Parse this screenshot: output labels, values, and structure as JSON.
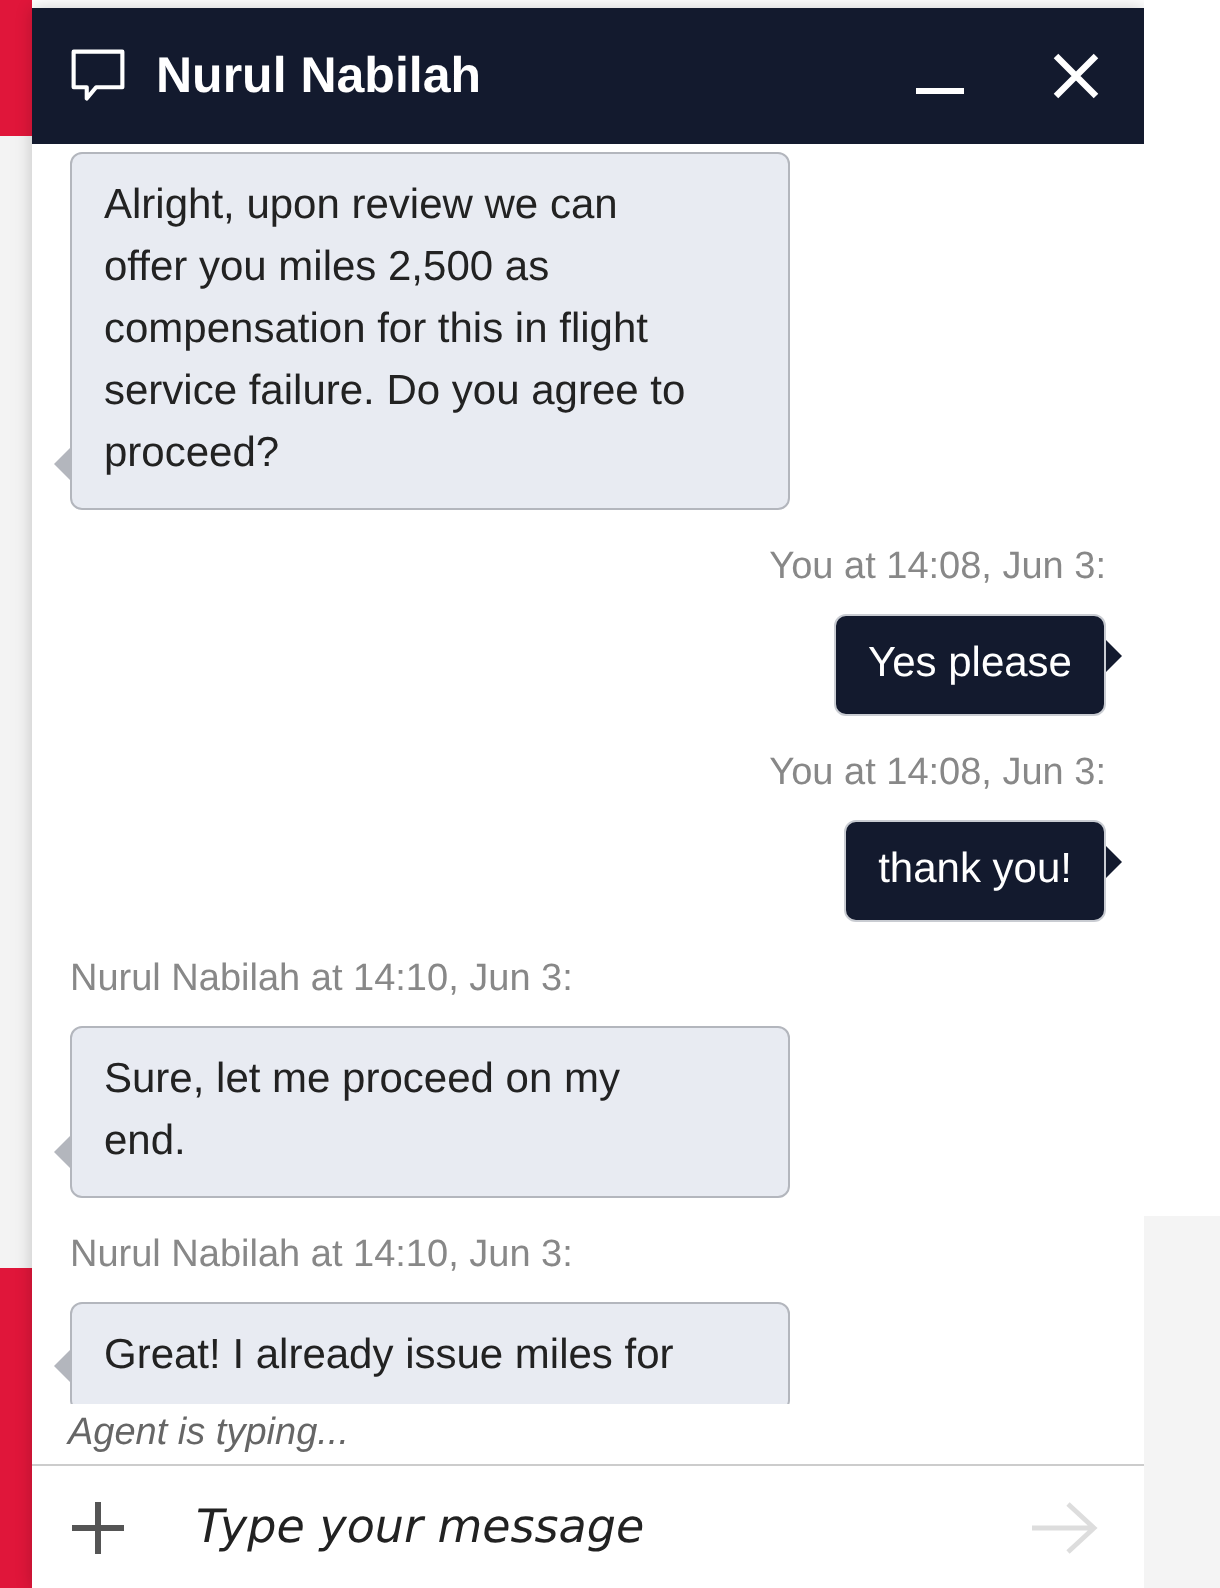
{
  "window": {
    "title": "Nurul Nabilah"
  },
  "messages": [
    {
      "kind": "agent",
      "text": "Alright, upon review we can offer you miles 2,500 as compensation for this in flight service failure. Do you agree to proceed?"
    },
    {
      "kind": "user",
      "meta": "You at 14:08, Jun 3:",
      "text": "Yes please"
    },
    {
      "kind": "user",
      "meta": "You at 14:08, Jun 3:",
      "text": "thank you!"
    },
    {
      "kind": "agent",
      "meta": "Nurul Nabilah at 14:10, Jun 3:",
      "text": "Sure, let me proceed on my end."
    },
    {
      "kind": "agent",
      "meta": "Nurul Nabilah at 14:10, Jun 3:",
      "text": "Great! I already issue miles for"
    }
  ],
  "typing": "Agent is typing...",
  "composer": {
    "placeholder": "Type your message"
  }
}
